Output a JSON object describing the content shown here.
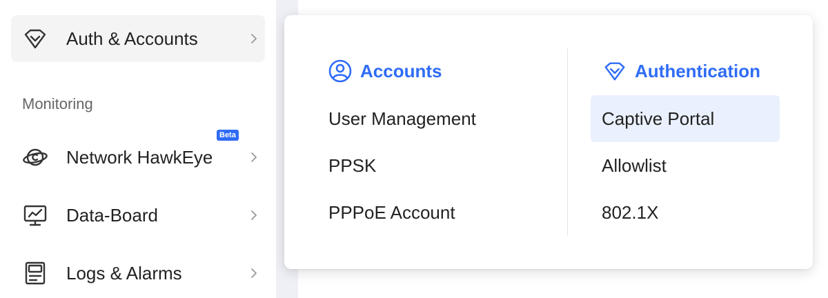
{
  "sidebar": {
    "auth_item": {
      "label": "Auth & Accounts",
      "icon": "diamond-shield-icon"
    },
    "section_label": "Monitoring",
    "items": [
      {
        "label": "Network HawkEye",
        "icon": "planet-icon",
        "badge": "Beta"
      },
      {
        "label": "Data-Board",
        "icon": "dashboard-monitor-icon"
      },
      {
        "label": "Logs & Alarms",
        "icon": "log-document-icon"
      }
    ]
  },
  "popover": {
    "accounts": {
      "title": "Accounts",
      "icon": "user-circle-icon",
      "links": [
        "User Management",
        "PPSK",
        "PPPoE Account"
      ]
    },
    "authentication": {
      "title": "Authentication",
      "icon": "diamond-shield-icon",
      "links": [
        "Captive Portal",
        "Allowlist",
        "802.1X"
      ],
      "highlighted": "Captive Portal"
    }
  },
  "colors": {
    "accent": "#2f6cf6",
    "highlight_bg": "#eaf0fd",
    "active_bg": "#f4f4f5",
    "gutter": "#eef0f5"
  }
}
